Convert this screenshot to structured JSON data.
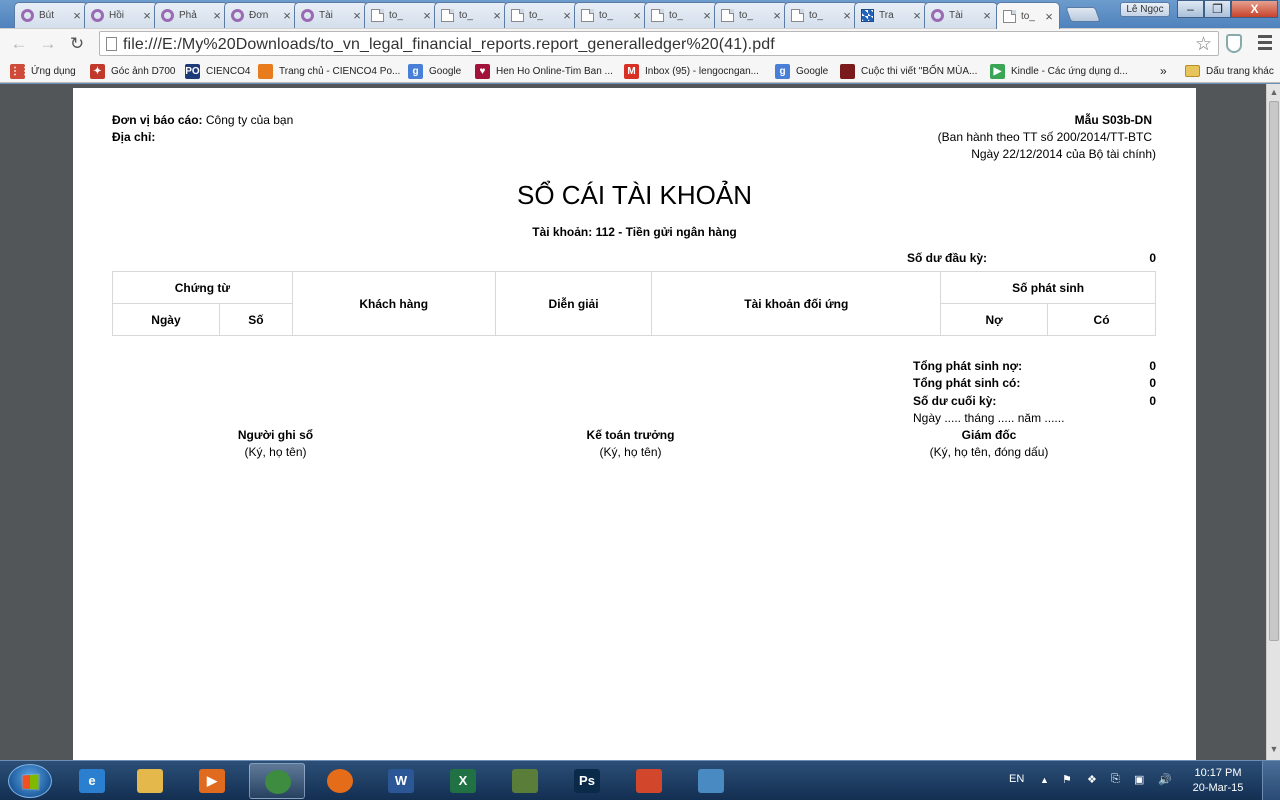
{
  "browser": {
    "tabs": [
      {
        "label": "Bút",
        "icon": "ring-icon"
      },
      {
        "label": "Hồi",
        "icon": "ring-icon"
      },
      {
        "label": "Phả",
        "icon": "ring-icon"
      },
      {
        "label": "Đơn",
        "icon": "ring-icon"
      },
      {
        "label": "Tài",
        "icon": "ring-icon"
      },
      {
        "label": "to_",
        "icon": "page-icon"
      },
      {
        "label": "to_",
        "icon": "page-icon"
      },
      {
        "label": "to_",
        "icon": "page-icon"
      },
      {
        "label": "to_",
        "icon": "page-icon"
      },
      {
        "label": "to_",
        "icon": "page-icon"
      },
      {
        "label": "to_",
        "icon": "page-icon"
      },
      {
        "label": "to_",
        "icon": "page-icon"
      },
      {
        "label": "Tra",
        "icon": "grid-icon"
      },
      {
        "label": "Tài",
        "icon": "ring-icon"
      },
      {
        "label": "to_",
        "icon": "page-icon",
        "active": true
      }
    ],
    "tab_close": "×",
    "user_name": "Lê Ngọc",
    "window_controls": {
      "minimize": "–",
      "maximize": "❐",
      "close": "X"
    },
    "url": "file:///E:/My%20Downloads/to_vn_legal_financial_reports.report_generalledger%20(41).pdf",
    "bookmarks": [
      {
        "label": "Ứng dụng",
        "icon": "apps-grid-icon"
      },
      {
        "label": "Góc ảnh D700",
        "icon": "star-badge-icon"
      },
      {
        "label": "CIENCO4",
        "icon": "po-icon"
      },
      {
        "label": "Trang chủ - CIENCO4 Po...",
        "icon": "firefox-icon"
      },
      {
        "label": "Google",
        "icon": "google-icon"
      },
      {
        "label": "Hen Ho Online-Tim Ban ...",
        "icon": "heart-icon"
      },
      {
        "label": "Inbox (95) - lengocngan...",
        "icon": "gmail-icon"
      },
      {
        "label": "Google",
        "icon": "google-icon"
      },
      {
        "label": "Cuộc thi viết \"BỐN MÙA...",
        "icon": "cup-icon"
      },
      {
        "label": "Kindle - Các ứng dụng d...",
        "icon": "play-store-icon"
      }
    ],
    "bookmarks_overflow": "»",
    "other_bookmarks": "Dấu trang khác"
  },
  "report": {
    "unit_label": "Đơn vị báo cáo:",
    "unit_value": "Công ty của bạn",
    "address_label": "Địa chỉ:",
    "form_code": "Mẫu S03b-DN",
    "form_issued_line1": "(Ban hành theo TT số 200/2014/TT-BTC",
    "form_issued_line2": "Ngày 22/12/2014 của Bộ tài chính)",
    "title": "SỔ CÁI TÀI KHOẢN",
    "account": "Tài khoản: 112 - Tiền gửi ngân hàng",
    "opening_balance_label": "Số dư đầu kỳ:",
    "opening_balance_value": "0",
    "table_headers": {
      "voucher": "Chứng từ",
      "date": "Ngày",
      "number": "Số",
      "customer": "Khách hàng",
      "description": "Diễn giải",
      "counter_account": "Tài khoản đối ứng",
      "amount": "Số phát sinh",
      "debit": "Nợ",
      "credit": "Có"
    },
    "total_debit_label": "Tổng phát sinh nợ:",
    "total_debit_value": "0",
    "total_credit_label": "Tổng phát sinh có:",
    "total_credit_value": "0",
    "closing_balance_label": "Số dư cuối kỳ:",
    "closing_balance_value": "0",
    "date_line": "Ngày ..... tháng ..... năm ......",
    "signatures": [
      {
        "role": "Người ghi sổ",
        "note": "(Ký, họ tên)"
      },
      {
        "role": "Kế toán trưởng",
        "note": "(Ký, họ tên)"
      },
      {
        "role": "Giám đốc",
        "note": "(Ký, họ tên, đóng dấu)"
      }
    ]
  },
  "taskbar": {
    "apps": [
      {
        "name": "internet-explorer",
        "glyph": "e"
      },
      {
        "name": "file-explorer",
        "glyph": ""
      },
      {
        "name": "media-player",
        "glyph": "▶"
      },
      {
        "name": "chrome",
        "glyph": "",
        "open": true
      },
      {
        "name": "firefox",
        "glyph": ""
      },
      {
        "name": "word",
        "glyph": "W"
      },
      {
        "name": "excel",
        "glyph": "X"
      },
      {
        "name": "presentation",
        "glyph": ""
      },
      {
        "name": "photoshop",
        "glyph": "Ps"
      },
      {
        "name": "app-grid",
        "glyph": ""
      },
      {
        "name": "photo-viewer",
        "glyph": ""
      }
    ],
    "language": "EN",
    "time": "10:17 PM",
    "date": "20-Mar-15"
  }
}
